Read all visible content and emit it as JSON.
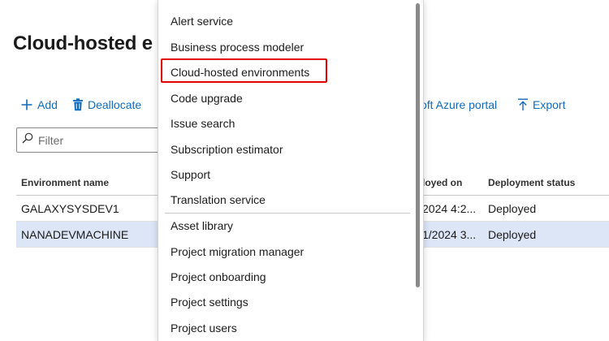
{
  "page": {
    "title": "Cloud-hosted e"
  },
  "toolbar": {
    "add_label": "Add",
    "deallocate_label": "Deallocate",
    "azure_label": "oft Azure portal",
    "export_label": "Export"
  },
  "filter": {
    "placeholder": "Filter"
  },
  "grid": {
    "columns": {
      "name": "Environment name",
      "deployed_on": "loyed on",
      "status": "Deployment status"
    },
    "rows": [
      {
        "name": "GALAXYSYSDEV1",
        "deployed_on": "2024 4:2...",
        "status": "Deployed",
        "selected": false
      },
      {
        "name": "NANADEVMACHINE",
        "deployed_on": "1/2024 3...",
        "status": "Deployed",
        "selected": true
      }
    ]
  },
  "menu": {
    "items": [
      "Alert service",
      "Business process modeler",
      "Cloud-hosted environments",
      "Code upgrade",
      "Issue search",
      "Subscription estimator",
      "Support",
      "Translation service",
      "Asset library",
      "Project migration manager",
      "Project onboarding",
      "Project settings",
      "Project users"
    ],
    "highlighted_item": "Cloud-hosted environments"
  },
  "colors": {
    "accent": "#0f6cbd",
    "selected_row": "#dce6f7",
    "highlight_border": "#e00000"
  }
}
